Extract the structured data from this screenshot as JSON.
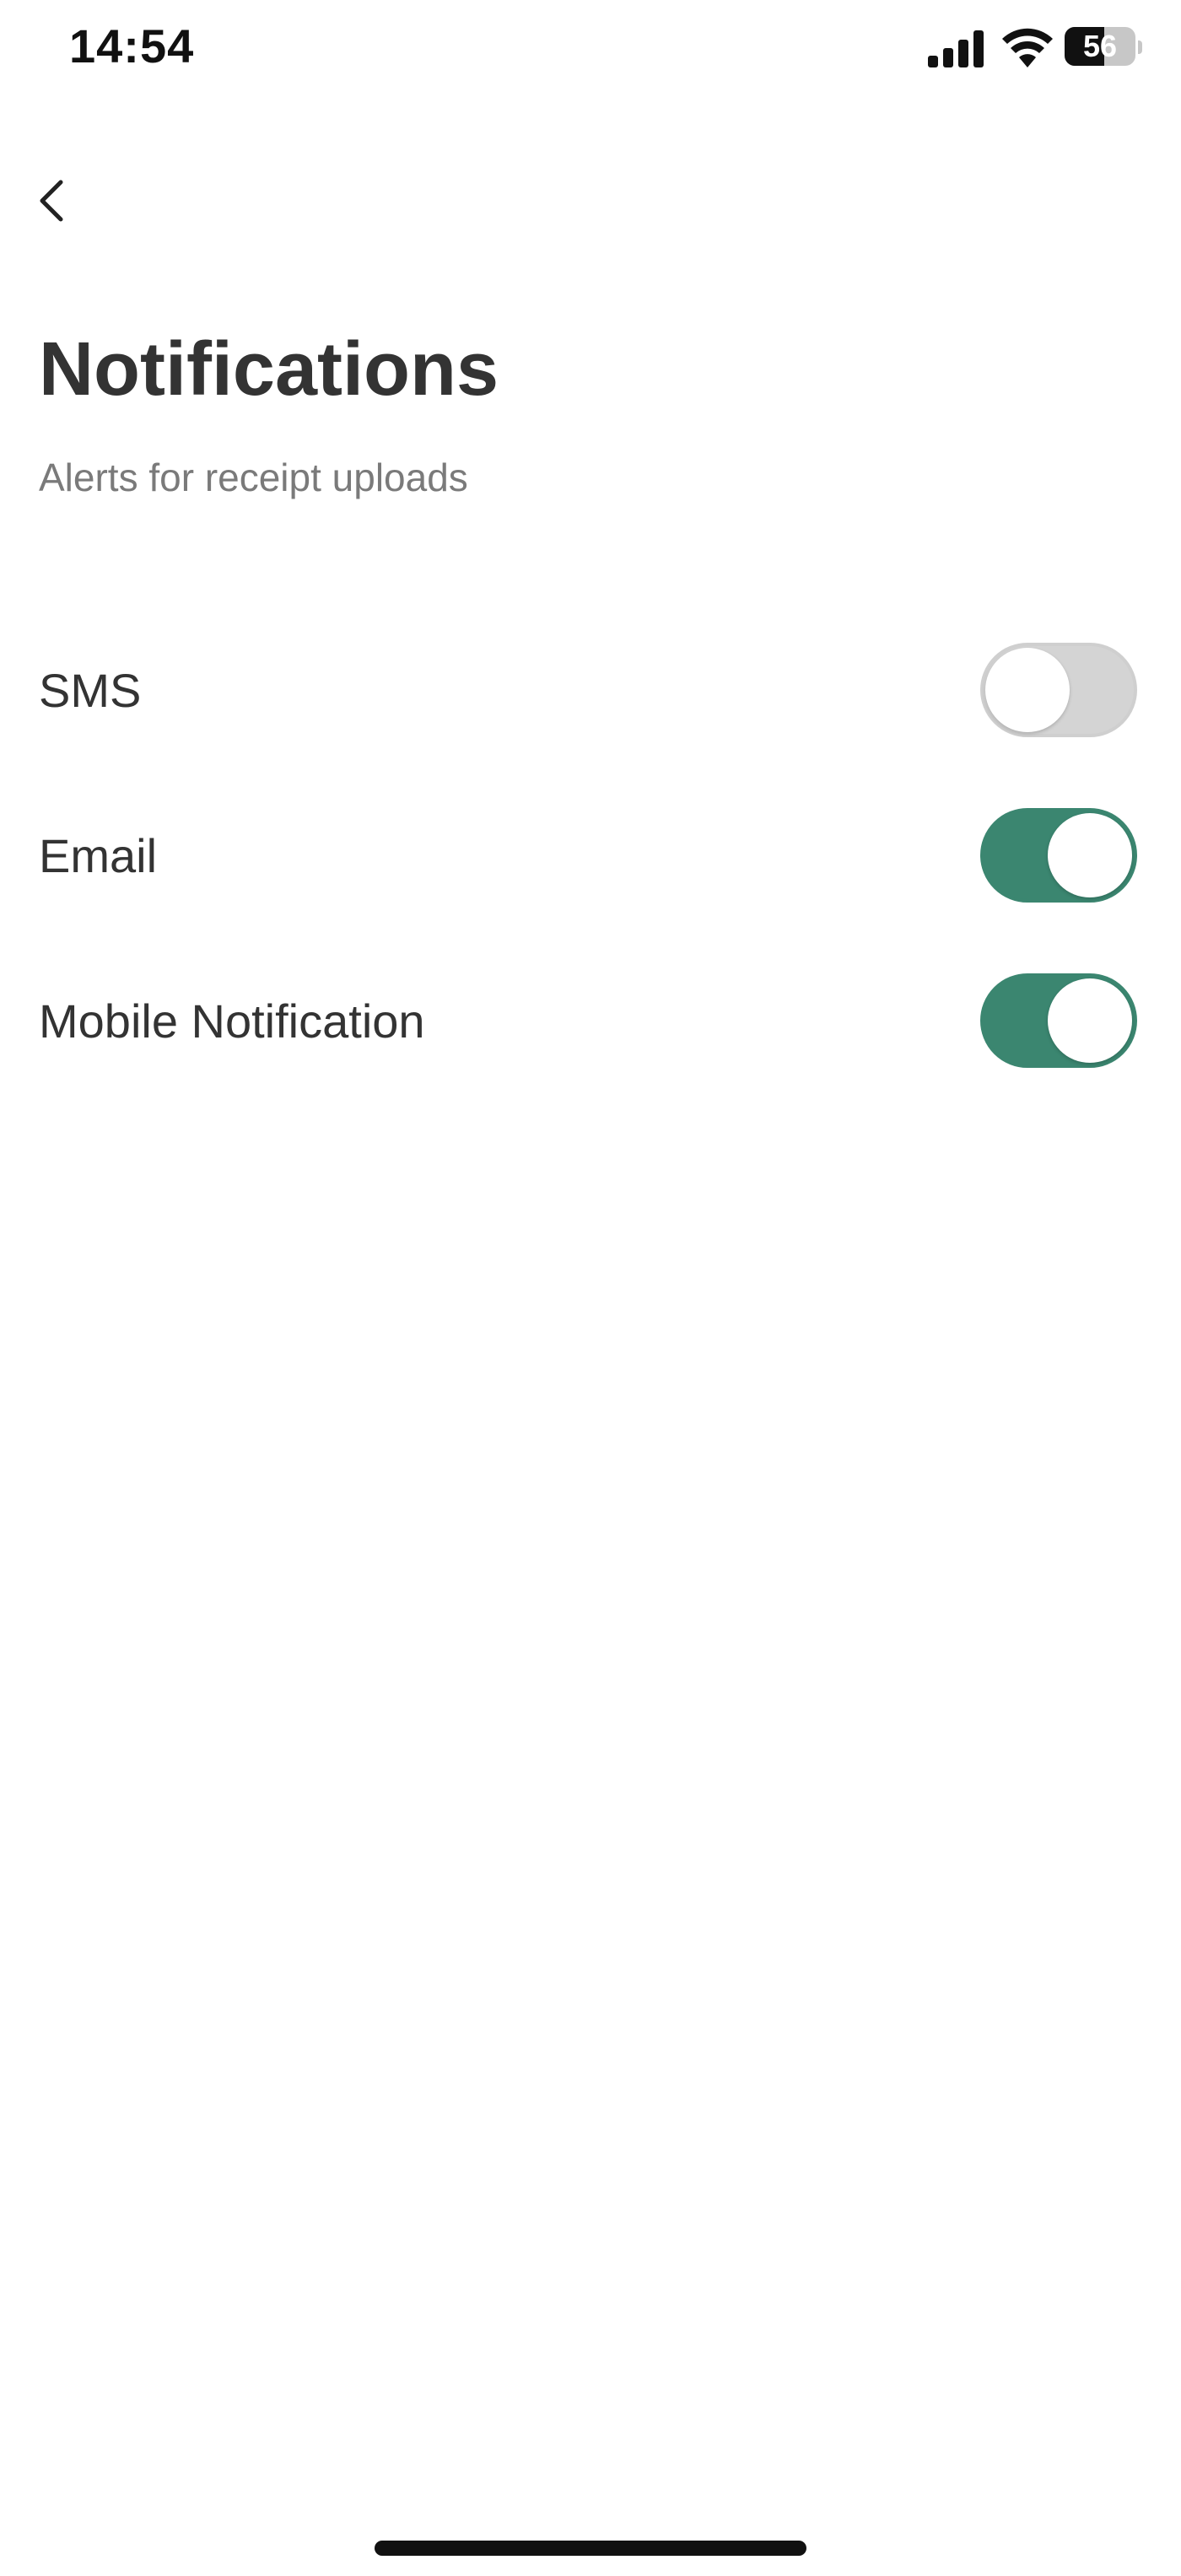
{
  "status_bar": {
    "time": "14:54",
    "battery_level": "56",
    "icons": [
      "signal-icon",
      "wifi-icon",
      "battery-icon"
    ]
  },
  "header": {
    "back_icon": "chevron-left-icon",
    "title": "Notifications",
    "subtitle": "Alerts for receipt uploads"
  },
  "settings": [
    {
      "label": "SMS",
      "enabled": false
    },
    {
      "label": "Email",
      "enabled": true
    },
    {
      "label": "Mobile Notification",
      "enabled": true
    }
  ],
  "colors": {
    "accent": "#3b8670",
    "toggle_off": "#d4d4d4",
    "title_text": "#333333",
    "subtitle_text": "#7a7a7a"
  }
}
